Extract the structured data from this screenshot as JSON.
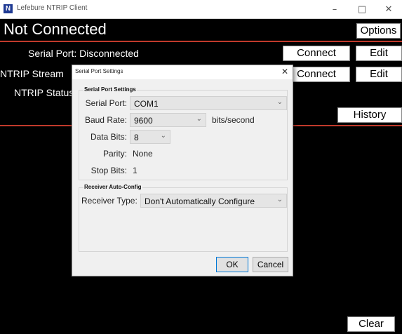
{
  "window": {
    "app_icon_letter": "N",
    "title": "Lefebure NTRIP Client",
    "minimize_glyph": "–",
    "maximize_glyph": "□",
    "close_glyph": "✕"
  },
  "main": {
    "status_heading": "Not Connected",
    "options_label": "Options",
    "serial_port_status": "Serial Port: Disconnected",
    "connect_label": "Connect",
    "edit_label": "Edit",
    "ntrip_stream_label": "NTRIP Stream",
    "ntrip_status_label": "NTRIP Status",
    "history_label": "History",
    "clear_label": "Clear"
  },
  "dialog": {
    "title": "Serial Port Settings",
    "close_glyph": "✕",
    "serial_group": {
      "heading": "Serial Port Settings",
      "serial_port_label": "Serial Port:",
      "serial_port_value": "COM1",
      "baud_rate_label": "Baud Rate:",
      "baud_rate_value": "9600",
      "baud_unit": "bits/second",
      "data_bits_label": "Data Bits:",
      "data_bits_value": "8",
      "parity_label": "Parity:",
      "parity_value": "None",
      "stop_bits_label": "Stop Bits:",
      "stop_bits_value": "1"
    },
    "receiver_group": {
      "heading": "Receiver Auto-Config",
      "receiver_type_label": "Receiver Type:",
      "receiver_type_value": "Don't Automatically Configure"
    },
    "ok_label": "OK",
    "cancel_label": "Cancel"
  },
  "icons": {
    "dropdown_chevron": "⌄"
  },
  "colors": {
    "background": "#000000",
    "accent_line": "#c0392b",
    "app_icon": "#1f3a93"
  }
}
